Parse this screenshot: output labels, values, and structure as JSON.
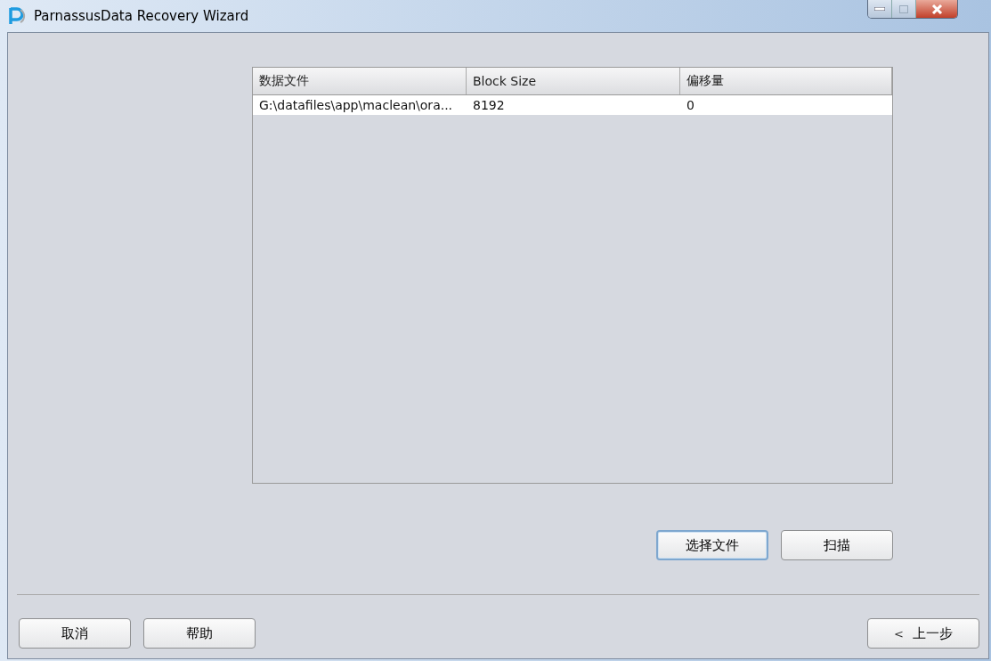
{
  "window": {
    "title": "ParnassusData Recovery Wizard"
  },
  "table": {
    "columns": [
      "数据文件",
      "Block Size",
      "偏移量"
    ],
    "rows": [
      [
        "G:\\datafiles\\app\\maclean\\ora...",
        "8192",
        "0"
      ]
    ]
  },
  "action_buttons": [
    {
      "label": "选择文件",
      "focused": true
    },
    {
      "label": "扫描",
      "focused": false
    }
  ],
  "footer_left_buttons": [
    {
      "label": "取消"
    },
    {
      "label": "帮助"
    }
  ],
  "footer_right_buttons": [
    {
      "icon": "<",
      "label": "上一步"
    }
  ]
}
